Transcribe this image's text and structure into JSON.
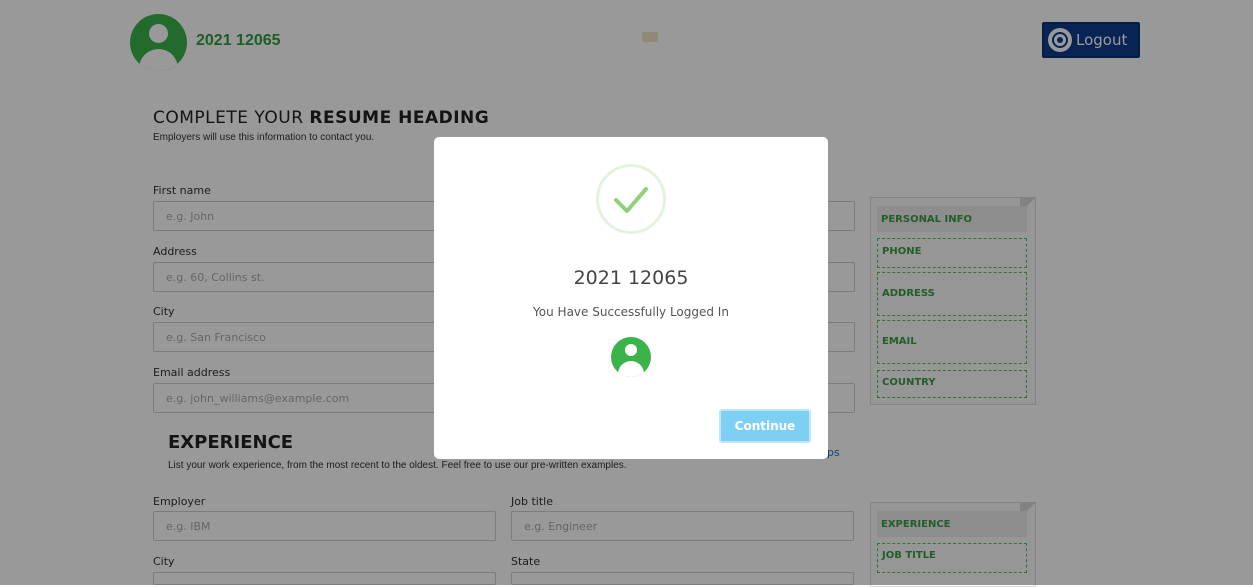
{
  "header": {
    "user_name": "2021 12065",
    "logout_label": "Logout"
  },
  "heading_section": {
    "title_prefix": "COMPLETE YOUR ",
    "title_bold": "RESUME HEADING",
    "subtitle": "Employers will use this information to contact you."
  },
  "form": {
    "first_name": {
      "label": "First name",
      "placeholder": "e.g. John"
    },
    "address": {
      "label": "Address",
      "placeholder": "e.g. 60, Collins st."
    },
    "city": {
      "label": "City",
      "placeholder": "e.g. San Francisco"
    },
    "email": {
      "label": "Email address",
      "placeholder": "e.g. john_williams@example.com"
    }
  },
  "preview_panel": {
    "header": "PERSONAL INFO",
    "items": [
      "PHONE",
      "ADDRESS",
      "EMAIL",
      "COUNTRY"
    ]
  },
  "experience_section": {
    "title": "EXPERIENCE",
    "subtitle": "List your work experience, from the most recent to the oldest. Feel free to use our pre-written examples.",
    "tips_link": "ps",
    "employer": {
      "label": "Employer",
      "placeholder": "e.g. IBM"
    },
    "job_title": {
      "label": "Job title",
      "placeholder": "e.g. Engineer"
    },
    "city_label": "City",
    "state_label": "State"
  },
  "experience_panel": {
    "header": "EXPERIENCE",
    "items": [
      "JOB TITLE"
    ]
  },
  "modal": {
    "title": "2021 12065",
    "message": "You Have Successfully Logged In",
    "continue_label": "Continue"
  },
  "colors": {
    "brand_green": "#3bb34a",
    "logout_blue": "#0d3d8c",
    "continue_blue": "#7ecff4"
  }
}
